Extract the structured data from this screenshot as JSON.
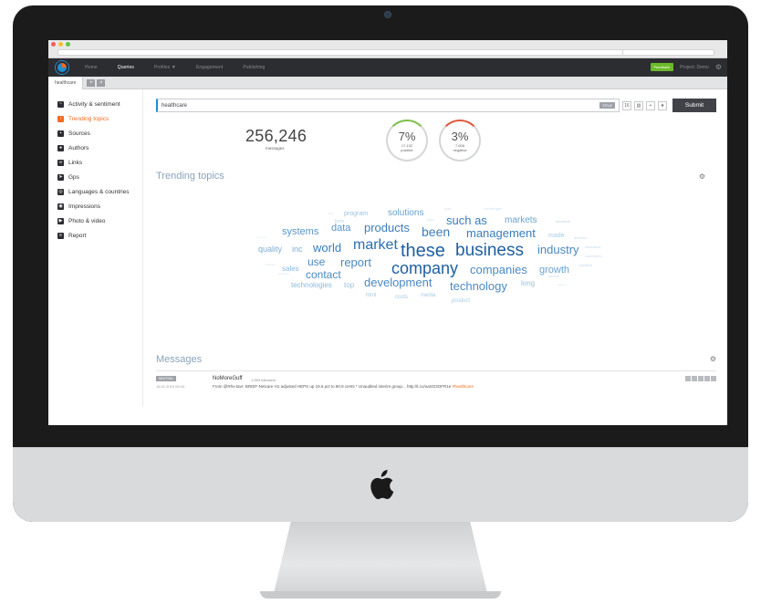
{
  "nav": {
    "items": [
      "Home",
      "Queries",
      "Profiles ▼",
      "Engagement",
      "Publishing"
    ],
    "active_index": 1,
    "badge": "Feedback",
    "project": "Project: Demo"
  },
  "tabs": {
    "label": "healthcare"
  },
  "sidebar": {
    "items": [
      {
        "label": "Activity & sentiment",
        "icon": "chart-icon"
      },
      {
        "label": "Trending topics",
        "icon": "trend-icon"
      },
      {
        "label": "Sources",
        "icon": "source-icon"
      },
      {
        "label": "Authors",
        "icon": "author-icon"
      },
      {
        "label": "Links",
        "icon": "link-icon"
      },
      {
        "label": "Gps",
        "icon": "gps-icon"
      },
      {
        "label": "Languages & countries",
        "icon": "globe-icon"
      },
      {
        "label": "Impressions",
        "icon": "eye-icon"
      },
      {
        "label": "Photo & video",
        "icon": "play-icon"
      },
      {
        "label": "Report",
        "icon": "report-icon"
      }
    ],
    "active_index": 1
  },
  "query": {
    "value": "healthcare",
    "title_tag": "TITLE",
    "submit": "Submit"
  },
  "stats": {
    "messages": "256,246",
    "messages_label": "messages",
    "positive_pct": "7%",
    "positive_count": "17,132",
    "positive_label": "positive",
    "negative_pct": "3%",
    "negative_count": "7,608",
    "negative_label": "negative"
  },
  "sections": {
    "trending": "Trending topics",
    "messages": "Messages"
  },
  "wordcloud": [
    {
      "t": "these",
      "c": "#1f5fa0"
    },
    {
      "t": "business",
      "c": "#1f5fa0"
    },
    {
      "t": "company",
      "c": "#1f5fa0"
    },
    {
      "t": "market",
      "c": "#2a6fb0"
    },
    {
      "t": "world",
      "c": "#3a7dbd"
    },
    {
      "t": "products",
      "c": "#3a7dbd"
    },
    {
      "t": "been",
      "c": "#3a7dbd"
    },
    {
      "t": "such as",
      "c": "#3a7dbd"
    },
    {
      "t": "management",
      "c": "#3a7dbd"
    },
    {
      "t": "industry",
      "c": "#4b89c4"
    },
    {
      "t": "companies",
      "c": "#4b89c4"
    },
    {
      "t": "development",
      "c": "#4b89c4"
    },
    {
      "t": "technology",
      "c": "#4b89c4"
    },
    {
      "t": "report",
      "c": "#4b89c4"
    },
    {
      "t": "contact",
      "c": "#4b89c4"
    },
    {
      "t": "use",
      "c": "#4b89c4"
    },
    {
      "t": "data",
      "c": "#5a96cc"
    },
    {
      "t": "systems",
      "c": "#5a96cc"
    },
    {
      "t": "solutions",
      "c": "#6aa2d2"
    },
    {
      "t": "markets",
      "c": "#6aa2d2"
    },
    {
      "t": "growth",
      "c": "#6aa2d2"
    },
    {
      "t": "quality",
      "c": "#7eafd8"
    },
    {
      "t": "inc",
      "c": "#7eafd8"
    },
    {
      "t": "sales",
      "c": "#8cb8dc"
    },
    {
      "t": "technologies",
      "c": "#8cb8dc"
    },
    {
      "t": "top",
      "c": "#9cc2e1"
    },
    {
      "t": "long",
      "c": "#9cc2e1"
    },
    {
      "t": "program",
      "c": "#9cc2e1"
    },
    {
      "t": "made",
      "c": "#a9cbe5"
    },
    {
      "t": "html",
      "c": "#a9cbe5"
    },
    {
      "t": "costs",
      "c": "#a9cbe5"
    },
    {
      "t": "media",
      "c": "#a9cbe5"
    },
    {
      "t": "product",
      "c": "#a9cbe5"
    },
    {
      "t": "form",
      "c": "#b8d3ea"
    },
    {
      "t": "medicine",
      "c": "#b8d3ea"
    },
    {
      "t": "america",
      "c": "#c4dbee"
    },
    {
      "t": "insurance",
      "c": "#c4dbee"
    },
    {
      "t": "customers",
      "c": "#c4dbee"
    },
    {
      "t": "addition",
      "c": "#c4dbee"
    },
    {
      "t": "source",
      "c": "#c4dbee"
    },
    {
      "t": "challenges",
      "c": "#cfe1f1"
    },
    {
      "t": "view",
      "c": "#cfe1f1"
    },
    {
      "t": "plan",
      "c": "#cfe1f1"
    },
    {
      "t": "topic",
      "c": "#d6e6f3"
    },
    {
      "t": "services",
      "c": "#d6e6f3"
    },
    {
      "t": "analysis",
      "c": "#d6e6f3"
    },
    {
      "t": "research",
      "c": "#d6e6f3"
    },
    {
      "t": "health",
      "c": "#d6e6f3"
    },
    {
      "t": "patients",
      "c": "#d6e6f3"
    }
  ],
  "message": {
    "sentiment": "NEUTRAL",
    "date": "16.01.2013 09:43",
    "author": "NoMoreGuff",
    "followers": "1,993 followers",
    "text": "From @Rhv-tavr: BRIEF-Netcare H1 adjusted HEPS up 19.6 pct to 90.8 cents * Unaudited interim group...",
    "link": "http://t.co/uaSO3OFR1e",
    "hashtag": "#healthcare"
  }
}
